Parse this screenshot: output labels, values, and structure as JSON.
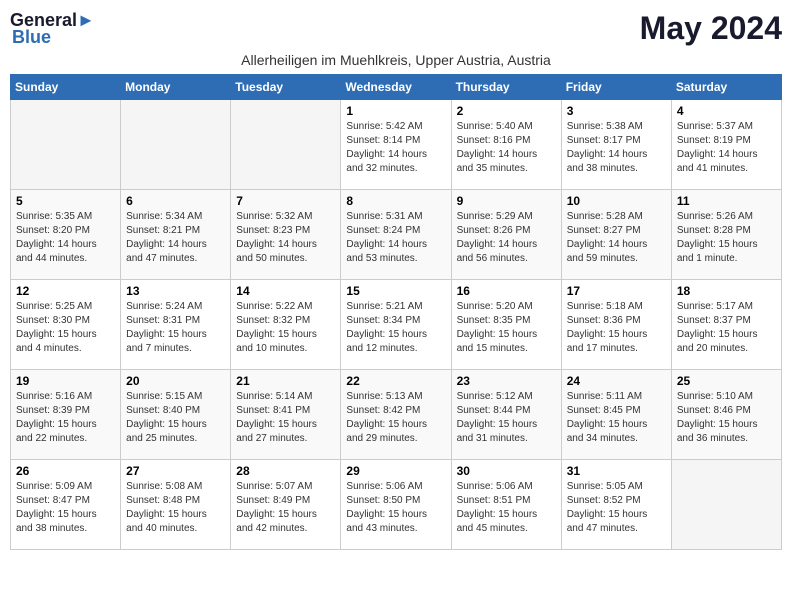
{
  "logo": {
    "general": "General",
    "blue": "Blue",
    "icon": "▶"
  },
  "title": "May 2024",
  "subtitle": "Allerheiligen im Muehlkreis, Upper Austria, Austria",
  "days_of_week": [
    "Sunday",
    "Monday",
    "Tuesday",
    "Wednesday",
    "Thursday",
    "Friday",
    "Saturday"
  ],
  "weeks": [
    [
      {
        "day": null,
        "sunrise": null,
        "sunset": null,
        "daylight": null
      },
      {
        "day": null,
        "sunrise": null,
        "sunset": null,
        "daylight": null
      },
      {
        "day": null,
        "sunrise": null,
        "sunset": null,
        "daylight": null
      },
      {
        "day": "1",
        "sunrise": "5:42 AM",
        "sunset": "8:14 PM",
        "daylight": "14 hours and 32 minutes."
      },
      {
        "day": "2",
        "sunrise": "5:40 AM",
        "sunset": "8:16 PM",
        "daylight": "14 hours and 35 minutes."
      },
      {
        "day": "3",
        "sunrise": "5:38 AM",
        "sunset": "8:17 PM",
        "daylight": "14 hours and 38 minutes."
      },
      {
        "day": "4",
        "sunrise": "5:37 AM",
        "sunset": "8:19 PM",
        "daylight": "14 hours and 41 minutes."
      }
    ],
    [
      {
        "day": "5",
        "sunrise": "5:35 AM",
        "sunset": "8:20 PM",
        "daylight": "14 hours and 44 minutes."
      },
      {
        "day": "6",
        "sunrise": "5:34 AM",
        "sunset": "8:21 PM",
        "daylight": "14 hours and 47 minutes."
      },
      {
        "day": "7",
        "sunrise": "5:32 AM",
        "sunset": "8:23 PM",
        "daylight": "14 hours and 50 minutes."
      },
      {
        "day": "8",
        "sunrise": "5:31 AM",
        "sunset": "8:24 PM",
        "daylight": "14 hours and 53 minutes."
      },
      {
        "day": "9",
        "sunrise": "5:29 AM",
        "sunset": "8:26 PM",
        "daylight": "14 hours and 56 minutes."
      },
      {
        "day": "10",
        "sunrise": "5:28 AM",
        "sunset": "8:27 PM",
        "daylight": "14 hours and 59 minutes."
      },
      {
        "day": "11",
        "sunrise": "5:26 AM",
        "sunset": "8:28 PM",
        "daylight": "15 hours and 1 minute."
      }
    ],
    [
      {
        "day": "12",
        "sunrise": "5:25 AM",
        "sunset": "8:30 PM",
        "daylight": "15 hours and 4 minutes."
      },
      {
        "day": "13",
        "sunrise": "5:24 AM",
        "sunset": "8:31 PM",
        "daylight": "15 hours and 7 minutes."
      },
      {
        "day": "14",
        "sunrise": "5:22 AM",
        "sunset": "8:32 PM",
        "daylight": "15 hours and 10 minutes."
      },
      {
        "day": "15",
        "sunrise": "5:21 AM",
        "sunset": "8:34 PM",
        "daylight": "15 hours and 12 minutes."
      },
      {
        "day": "16",
        "sunrise": "5:20 AM",
        "sunset": "8:35 PM",
        "daylight": "15 hours and 15 minutes."
      },
      {
        "day": "17",
        "sunrise": "5:18 AM",
        "sunset": "8:36 PM",
        "daylight": "15 hours and 17 minutes."
      },
      {
        "day": "18",
        "sunrise": "5:17 AM",
        "sunset": "8:37 PM",
        "daylight": "15 hours and 20 minutes."
      }
    ],
    [
      {
        "day": "19",
        "sunrise": "5:16 AM",
        "sunset": "8:39 PM",
        "daylight": "15 hours and 22 minutes."
      },
      {
        "day": "20",
        "sunrise": "5:15 AM",
        "sunset": "8:40 PM",
        "daylight": "15 hours and 25 minutes."
      },
      {
        "day": "21",
        "sunrise": "5:14 AM",
        "sunset": "8:41 PM",
        "daylight": "15 hours and 27 minutes."
      },
      {
        "day": "22",
        "sunrise": "5:13 AM",
        "sunset": "8:42 PM",
        "daylight": "15 hours and 29 minutes."
      },
      {
        "day": "23",
        "sunrise": "5:12 AM",
        "sunset": "8:44 PM",
        "daylight": "15 hours and 31 minutes."
      },
      {
        "day": "24",
        "sunrise": "5:11 AM",
        "sunset": "8:45 PM",
        "daylight": "15 hours and 34 minutes."
      },
      {
        "day": "25",
        "sunrise": "5:10 AM",
        "sunset": "8:46 PM",
        "daylight": "15 hours and 36 minutes."
      }
    ],
    [
      {
        "day": "26",
        "sunrise": "5:09 AM",
        "sunset": "8:47 PM",
        "daylight": "15 hours and 38 minutes."
      },
      {
        "day": "27",
        "sunrise": "5:08 AM",
        "sunset": "8:48 PM",
        "daylight": "15 hours and 40 minutes."
      },
      {
        "day": "28",
        "sunrise": "5:07 AM",
        "sunset": "8:49 PM",
        "daylight": "15 hours and 42 minutes."
      },
      {
        "day": "29",
        "sunrise": "5:06 AM",
        "sunset": "8:50 PM",
        "daylight": "15 hours and 43 minutes."
      },
      {
        "day": "30",
        "sunrise": "5:06 AM",
        "sunset": "8:51 PM",
        "daylight": "15 hours and 45 minutes."
      },
      {
        "day": "31",
        "sunrise": "5:05 AM",
        "sunset": "8:52 PM",
        "daylight": "15 hours and 47 minutes."
      },
      {
        "day": null,
        "sunrise": null,
        "sunset": null,
        "daylight": null
      }
    ]
  ],
  "labels": {
    "sunrise": "Sunrise:",
    "sunset": "Sunset:",
    "daylight": "Daylight:"
  }
}
